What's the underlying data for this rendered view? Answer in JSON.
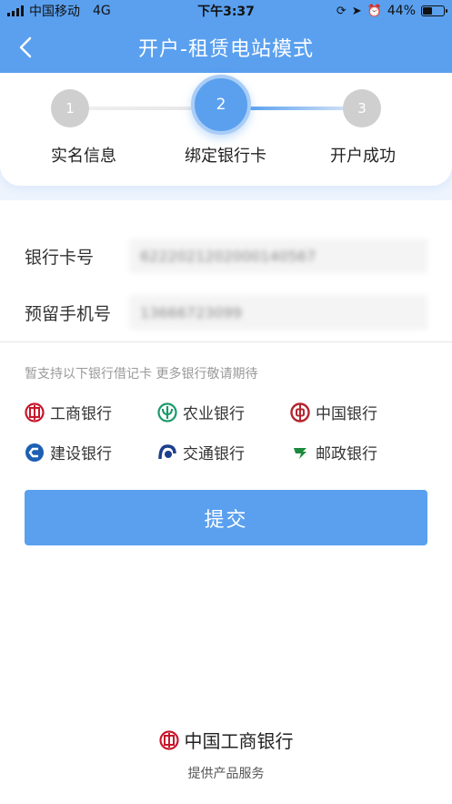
{
  "status_bar": {
    "carrier": "中国移动",
    "network": "4G",
    "time": "下午3:37",
    "battery_text": "44%",
    "battery_level": 0.44
  },
  "nav": {
    "title": "开户-租赁电站模式"
  },
  "stepper": {
    "steps": [
      {
        "number": "1",
        "label": "实名信息"
      },
      {
        "number": "2",
        "label": "绑定银行卡"
      },
      {
        "number": "3",
        "label": "开户成功"
      }
    ],
    "active_step": 2
  },
  "form": {
    "card_label": "银行卡号",
    "card_value": "6222021202000140567",
    "phone_label": "预留手机号",
    "phone_value": "13666723099"
  },
  "support_note": "暂支持以下银行借记卡 更多银行敬请期待",
  "banks": [
    {
      "name": "工商银行",
      "icon": "icbc-icon",
      "color": "#c7162b"
    },
    {
      "name": "农业银行",
      "icon": "abc-icon",
      "color": "#1a9a6b"
    },
    {
      "name": "中国银行",
      "icon": "boc-icon",
      "color": "#b5252f"
    },
    {
      "name": "建设银行",
      "icon": "ccb-icon",
      "color": "#1c5fb4"
    },
    {
      "name": "交通银行",
      "icon": "bocom-icon",
      "color": "#1c3f8c"
    },
    {
      "name": "邮政银行",
      "icon": "psbc-icon",
      "color": "#1a8a3c"
    }
  ],
  "submit_label": "提交",
  "footer": {
    "brand": "中国工商银行",
    "sub": "提供产品服务"
  },
  "colors": {
    "primary": "#5aa0ef",
    "inactive_step": "#cfcfcf"
  }
}
